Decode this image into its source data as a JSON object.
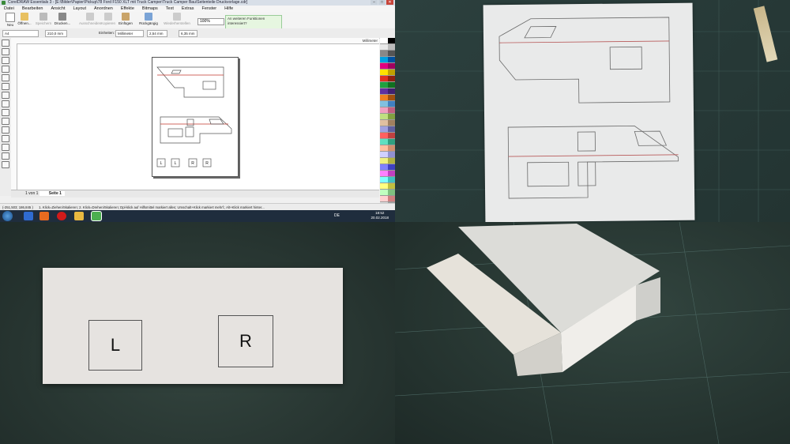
{
  "window": {
    "title": "CorelDRAW Essentials 3 - [E:\\Bilder\\Papier\\Pickup\\78 Ford F150 XLT mit Truck Camper\\Truck Camper Bau\\Seitenteile Druckvorlage.cdr]",
    "min": "–",
    "max": "□",
    "close": "✕"
  },
  "menu": [
    "Datei",
    "Bearbeiten",
    "Ansicht",
    "Layout",
    "Anordnen",
    "Effekte",
    "Bitmaps",
    "Text",
    "Extras",
    "Fenster",
    "Hilfe"
  ],
  "ribbon": {
    "buttons": [
      {
        "label": "Neu",
        "icon": "new-document-icon"
      },
      {
        "label": "Öffnen...",
        "icon": "open-folder-icon"
      },
      {
        "label": "Speichern",
        "icon": "save-icon"
      },
      {
        "label": "Drucken...",
        "icon": "print-icon"
      },
      {
        "label": "Ausschneiden",
        "icon": "cut-icon"
      },
      {
        "label": "Kopieren",
        "icon": "copy-icon"
      },
      {
        "label": "Einfügen",
        "icon": "paste-icon"
      },
      {
        "label": "Rückgängig",
        "icon": "undo-icon"
      },
      {
        "label": "Wiederherstellen",
        "icon": "redo-icon"
      }
    ],
    "zoom": "100%",
    "tip": "An weiteren Funktionen interessiert?"
  },
  "propbar": {
    "page_size": "A4",
    "width": "210,0 mm",
    "height": "297,0 mm",
    "units_label": "Einheiten:",
    "units": "Millimeter",
    "nudge": "2,54 mm",
    "dup_x": "6,35 mm",
    "dup_y": "6,35 mm"
  },
  "ruler": {
    "unit": "Millimeter"
  },
  "docnav": {
    "page_of": "1 von 1",
    "page_tab": "Seite 1"
  },
  "status": {
    "coords": "(-251,503; 186,845 )",
    "hint": "1. Klick=Ziehen/Skalieren; 2. Klick=Drehen/Skalieren; Dpl-klick auf Hilfsmittel markiert alles; Umschalt+Klick markiert mehrf.; Alt+Klick markiert hinter..."
  },
  "taskbar": {
    "lang": "DE",
    "time": "18:52",
    "date": "20.02.2018"
  },
  "page_labels": [
    "L",
    "L",
    "R",
    "R"
  ],
  "card_labels": {
    "left": "L",
    "right": "R"
  },
  "colors": {
    "taskbar": "#1f2d3d",
    "accent": "#3a8a3a",
    "cut_line": "#c0392b"
  }
}
